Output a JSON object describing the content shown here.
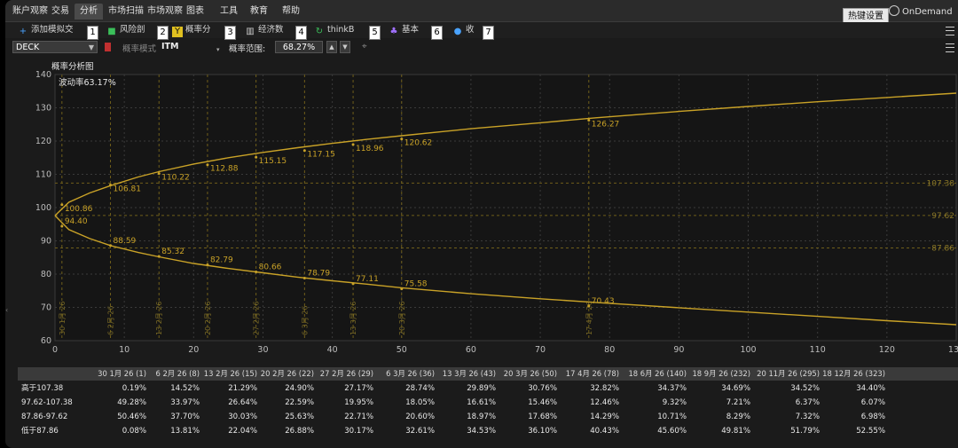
{
  "menu": {
    "items": [
      "账户观察",
      "交易",
      "分析",
      "市场扫描",
      "市场观察",
      "图表",
      "工具",
      "教育",
      "帮助"
    ],
    "active_index": 2,
    "hotkey_label": "热键设置",
    "ondemand_label": "OnDemand"
  },
  "toolbar": {
    "items": [
      {
        "label": "添加模拟交",
        "icon": "plus-icon",
        "badge": "1",
        "color": "#4aa3ff"
      },
      {
        "label": "风险剖",
        "icon": "risk-profile-icon",
        "badge": "2",
        "color": "#3bbf5a"
      },
      {
        "label": "概率分",
        "icon": "probability-icon",
        "badge": "3",
        "color": "#e0c020"
      },
      {
        "label": "经济数",
        "icon": "bank-icon",
        "badge": "4",
        "color": "#cccccc"
      },
      {
        "label": "thinkB",
        "icon": "thinkback-icon",
        "badge": "5",
        "color": "#3bbf5a"
      },
      {
        "label": "基本",
        "icon": "fundamentals-icon",
        "badge": "6",
        "color": "#a070ff"
      },
      {
        "label": "收",
        "icon": "lightbulb-icon",
        "badge": "7",
        "color": "#4aa3ff"
      }
    ]
  },
  "controls": {
    "symbol": "DECK",
    "mode_label": "概率模式",
    "mode_value": "ITM",
    "range_label": "概率范围:",
    "range_value": "68.27%"
  },
  "chart": {
    "title": "概率分析图",
    "volatility_label": "波动率63.17%",
    "line_color": "#c9a227"
  },
  "chart_data": {
    "type": "line",
    "title": "概率分析图",
    "annotation": "波动率63.17%",
    "xlim": [
      0,
      130
    ],
    "ylim": [
      60,
      140
    ],
    "x_ticks": [
      0,
      10,
      20,
      30,
      40,
      50,
      60,
      70,
      80,
      90,
      100,
      110,
      120,
      130
    ],
    "y_ticks": [
      60,
      70,
      80,
      90,
      100,
      110,
      120,
      130,
      140
    ],
    "series": [
      {
        "x": [
          0,
          2,
          5,
          8,
          12,
          15,
          20,
          25,
          30,
          35,
          40,
          45,
          50,
          60,
          70,
          78,
          90,
          100,
          110,
          120,
          130
        ],
        "values": [
          97.6,
          101.6,
          104.4,
          106.6,
          109.2,
          110.8,
          113.1,
          115.0,
          116.6,
          118.0,
          119.3,
          120.5,
          121.6,
          123.7,
          125.5,
          127.0,
          128.9,
          130.4,
          131.8,
          133.1,
          134.4
        ]
      },
      {
        "x": [
          0,
          2,
          5,
          8,
          12,
          15,
          20,
          25,
          30,
          35,
          40,
          45,
          50,
          60,
          70,
          78,
          90,
          100,
          110,
          120,
          130
        ],
        "values": [
          97.6,
          93.4,
          90.7,
          88.6,
          86.5,
          85.2,
          83.2,
          81.7,
          80.4,
          79.1,
          78.0,
          77.0,
          75.9,
          74.1,
          72.6,
          71.5,
          69.9,
          68.6,
          67.3,
          66.0,
          64.8
        ]
      }
    ],
    "upper_labels": [
      {
        "x": 1,
        "y": 100.86,
        "text": "100.86"
      },
      {
        "x": 8,
        "y": 106.81,
        "text": "106.81"
      },
      {
        "x": 15,
        "y": 110.22,
        "text": "110.22"
      },
      {
        "x": 22,
        "y": 112.88,
        "text": "112.88"
      },
      {
        "x": 29,
        "y": 115.15,
        "text": "115.15"
      },
      {
        "x": 36,
        "y": 117.15,
        "text": "117.15"
      },
      {
        "x": 43,
        "y": 118.96,
        "text": "118.96"
      },
      {
        "x": 50,
        "y": 120.62,
        "text": "120.62"
      },
      {
        "x": 77,
        "y": 126.27,
        "text": "126.27"
      }
    ],
    "lower_labels": [
      {
        "x": 1,
        "y": 94.4,
        "text": "94.40"
      },
      {
        "x": 8,
        "y": 88.59,
        "text": "88.59"
      },
      {
        "x": 15,
        "y": 85.32,
        "text": "85.32"
      },
      {
        "x": 22,
        "y": 82.79,
        "text": "82.79"
      },
      {
        "x": 29,
        "y": 80.66,
        "text": "80.66"
      },
      {
        "x": 36,
        "y": 78.79,
        "text": "78.79"
      },
      {
        "x": 43,
        "y": 77.11,
        "text": "77.11"
      },
      {
        "x": 50,
        "y": 75.58,
        "text": "75.58"
      },
      {
        "x": 77,
        "y": 70.43,
        "text": "70.43"
      }
    ],
    "h_levels": [
      {
        "y": 107.38,
        "text": "107.38"
      },
      {
        "y": 97.62,
        "text": "97.62"
      },
      {
        "y": 87.86,
        "text": "87.86"
      }
    ],
    "expirations": [
      {
        "x": 1,
        "text": "30 1月 26"
      },
      {
        "x": 8,
        "text": "6 2月 26"
      },
      {
        "x": 15,
        "text": "13 2月 26"
      },
      {
        "x": 22,
        "text": "20 2月 26"
      },
      {
        "x": 29,
        "text": "27 2月 26"
      },
      {
        "x": 36,
        "text": "6 3月 26"
      },
      {
        "x": 43,
        "text": "13 3月 26"
      },
      {
        "x": 50,
        "text": "20 3月 26"
      },
      {
        "x": 77,
        "text": "17 4月 26"
      }
    ]
  },
  "table": {
    "columns": [
      "30 1月 26 (1)",
      "6 2月 26 (8)",
      "13 2月 26 (15)",
      "20 2月 26 (22)",
      "27 2月 26 (29)",
      "6 3月 26 (36)",
      "13 3月 26 (43)",
      "20 3月 26 (50)",
      "17 4月 26 (78)",
      "18 6月 26 (140)",
      "18 9月 26 (232)",
      "20 11月 26 (295)",
      "18 12月 26 (323)"
    ],
    "rows": [
      {
        "label": "高于107.38",
        "values": [
          "0.19%",
          "14.52%",
          "21.29%",
          "24.90%",
          "27.17%",
          "28.74%",
          "29.89%",
          "30.76%",
          "32.82%",
          "34.37%",
          "34.69%",
          "34.52%",
          "34.40%"
        ]
      },
      {
        "label": "97.62-107.38",
        "values": [
          "49.28%",
          "33.97%",
          "26.64%",
          "22.59%",
          "19.95%",
          "18.05%",
          "16.61%",
          "15.46%",
          "12.46%",
          "9.32%",
          "7.21%",
          "6.37%",
          "6.07%"
        ]
      },
      {
        "label": "87.86-97.62",
        "values": [
          "50.46%",
          "37.70%",
          "30.03%",
          "25.63%",
          "22.71%",
          "20.60%",
          "18.97%",
          "17.68%",
          "14.29%",
          "10.71%",
          "8.29%",
          "7.32%",
          "6.98%"
        ]
      },
      {
        "label": "低于87.86",
        "values": [
          "0.08%",
          "13.81%",
          "22.04%",
          "26.88%",
          "30.17%",
          "32.61%",
          "34.53%",
          "36.10%",
          "40.43%",
          "45.60%",
          "49.81%",
          "51.79%",
          "52.55%"
        ]
      }
    ]
  }
}
